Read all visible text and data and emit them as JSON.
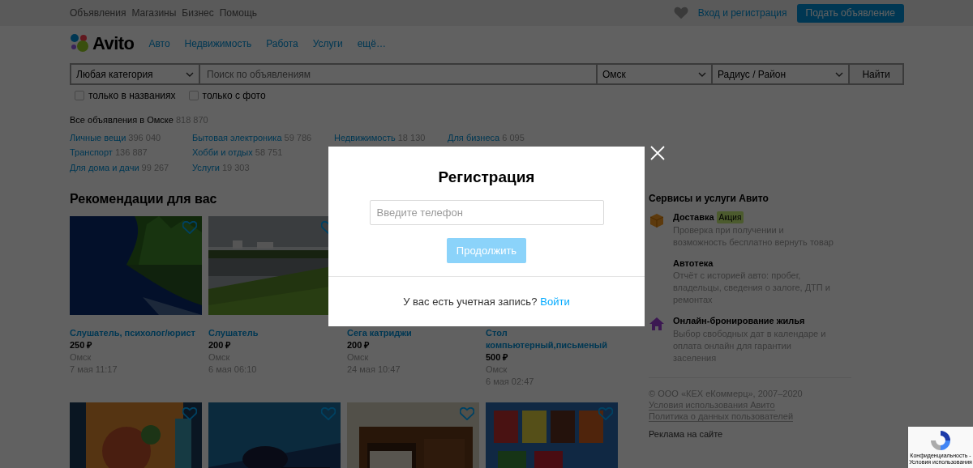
{
  "top_nav": {
    "links": [
      "Объявления",
      "Магазины",
      "Бизнес",
      "Помощь"
    ],
    "login": "Вход и регистрация",
    "post_button": "Подать объявление"
  },
  "header": {
    "logo": "Avito",
    "links": [
      "Авто",
      "Недвижимость",
      "Работа",
      "Услуги",
      "ещё…"
    ]
  },
  "search": {
    "category": "Любая категория",
    "placeholder": "Поиск по объявлениям",
    "city": "Омск",
    "radius": "Радиус / Район",
    "button": "Найти",
    "filters": [
      {
        "label": "только в названиях",
        "checked": false
      },
      {
        "label": "только с фото",
        "checked": false
      }
    ]
  },
  "categories": {
    "title": "Все объявления в Омске",
    "count": "818 870",
    "columns": [
      [
        {
          "name": "Личные вещи",
          "count": "396 040"
        },
        {
          "name": "Транспорт",
          "count": "136 887"
        },
        {
          "name": "Для дома и дачи",
          "count": "99 267"
        }
      ],
      [
        {
          "name": "Бытовая электроника",
          "count": "59 786"
        },
        {
          "name": "Хобби и отдых",
          "count": "58 751"
        },
        {
          "name": "Услуги",
          "count": "19 303"
        }
      ],
      [
        {
          "name": "Недвижимость",
          "count": "18 130"
        }
      ],
      [
        {
          "name": "Для бизнеса",
          "count": "6 095"
        }
      ]
    ]
  },
  "recommendations": {
    "title": "Рекомендации для вас",
    "cards": [
      {
        "title": "Слушатель, психолог/юрист",
        "price": "250 ₽",
        "city": "Омск",
        "date": "7 мая 11:17"
      },
      {
        "title": "Слушатель",
        "price": "200 ₽",
        "city": "Омск",
        "date": "6 мая 06:10"
      },
      {
        "title": "Сега катриджи",
        "price": "200 ₽",
        "city": "Омск",
        "date": "24 мая 10:47"
      },
      {
        "title": "Стол компьютерный,письменый",
        "price": "500 ₽",
        "city": "Омск",
        "date": "6 мая 02:47"
      }
    ]
  },
  "services": {
    "title": "Сервисы и услуги Авито",
    "items": [
      {
        "title": "Доставка",
        "badge": "Акция",
        "text": "Проверка при получении и возможность бесплатно вернуть товар",
        "kind": "box"
      },
      {
        "title": "Автотека",
        "text": "Отчёт с историей авто: пробег, владельцы, сведения о залоге, ДТП и ремонтах"
      },
      {
        "title": "Онлайн-бронирование жилья",
        "text": "Выбор свободных дат в календаре и оплата онлайн для гарантии заселения",
        "kind": "house"
      }
    ]
  },
  "footer": {
    "copyright": "© ООО «КЕХ еКоммерц», 2007–2020",
    "links": [
      "Условия использования Авито",
      "Политика о данных пользователей"
    ],
    "ad": "Реклама на сайте"
  },
  "modal": {
    "title": "Регистрация",
    "phone_placeholder": "Введите телефон",
    "continue_button": "Продолжить",
    "continue_disabled": true,
    "footer_text": "У вас есть учетная запись?",
    "login_link": "Войти"
  },
  "recaptcha": {
    "text": "Конфиденциальность - Условия использования"
  }
}
